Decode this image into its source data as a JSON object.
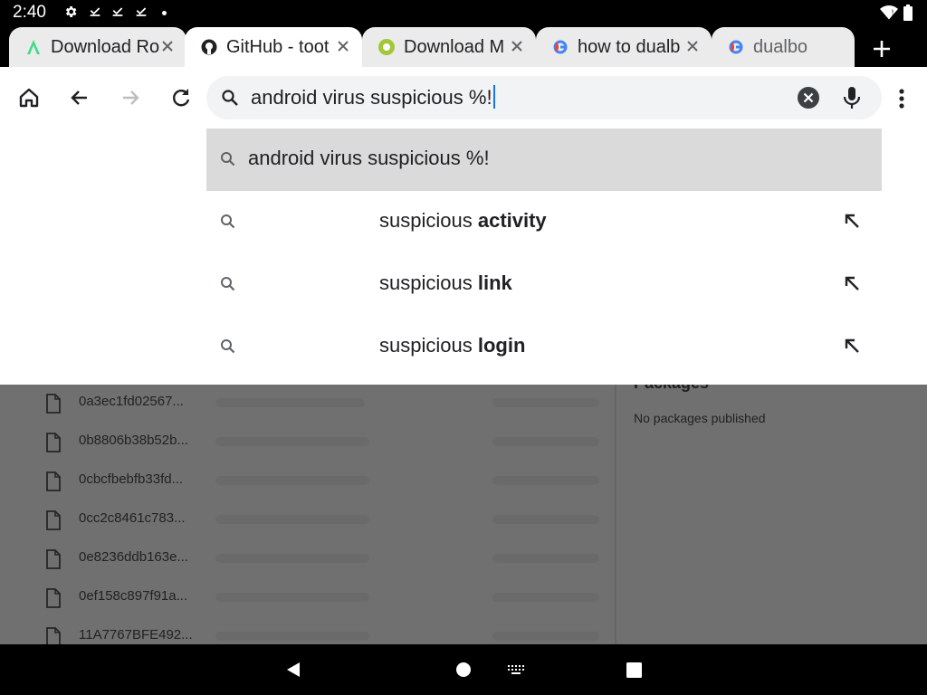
{
  "status_bar": {
    "time": "2:40",
    "icons": [
      "settings-icon",
      "download-done-icon",
      "download-done-icon",
      "download-done-icon",
      "dot-icon",
      "wifi-icon",
      "battery-icon"
    ]
  },
  "tabs": [
    {
      "title": "Download Ro",
      "favicon": "android-studio-icon",
      "active": false
    },
    {
      "title": "GitHub - toot",
      "favicon": "github-icon",
      "active": true
    },
    {
      "title": "Download M",
      "favicon": "android-icon",
      "active": false
    },
    {
      "title": "how to dualb",
      "favicon": "google-icon",
      "active": false
    },
    {
      "title": "dualbo",
      "favicon": "google-icon",
      "active": false
    }
  ],
  "omnibox": {
    "query": "android virus suspicious %!"
  },
  "suggestions": [
    {
      "plain": "android virus suspicious %!",
      "bold": "",
      "highlighted": true
    },
    {
      "plain": "suspicious ",
      "bold": "activity",
      "highlighted": false
    },
    {
      "plain": "suspicious ",
      "bold": "link",
      "highlighted": false
    },
    {
      "plain": "suspicious ",
      "bold": "login",
      "highlighted": false
    }
  ],
  "page": {
    "files": [
      "0a3ec1fd02567...",
      "0b8806b38b52b...",
      "0cbcfbebfb33fd...",
      "0cc2c8461c783...",
      "0e8236ddb163e...",
      "0ef158c897f91a...",
      "11A7767BFE492..."
    ],
    "packages_heading": "Packages",
    "packages_text": "No packages published"
  },
  "colors": {
    "accent": "#1a73e8",
    "highlight_row": "#dadada",
    "scrim": "#707070"
  }
}
